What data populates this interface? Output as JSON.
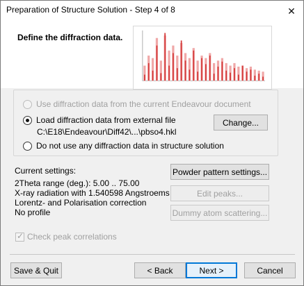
{
  "window": {
    "title": "Preparation of Structure Solution - Step 4 of 8",
    "close_glyph": "✕"
  },
  "header": {
    "heading": "Define the diffraction data."
  },
  "source_options": {
    "use_current": "Use diffraction data from the current Endeavour document",
    "load_external": "Load diffraction data from external file",
    "file_path": "C:\\E18\\Endeavour\\Diff42\\...\\pbso4.hkl",
    "do_not_use": "Do not use any diffraction data in structure solution",
    "selected": "load_external"
  },
  "buttons": {
    "change": "Change...",
    "powder_settings": "Powder pattern settings...",
    "edit_peaks": "Edit peaks...",
    "dummy_atom": "Dummy atom scattering...",
    "save_quit": "Save & Quit",
    "back": "< Back",
    "next": "Next >",
    "cancel": "Cancel"
  },
  "current_settings": {
    "label": "Current settings:",
    "lines": [
      "2Theta range (deg.): 5.00 .. 75.00",
      "X-ray radiation with 1.540598 Angstroems",
      "Lorentz- and Polarisation correction",
      "No profile"
    ]
  },
  "check_peak_correlations": {
    "label": "Check peak correlations",
    "checked": true,
    "enabled": false
  },
  "chart_data": {
    "type": "bar",
    "series": [
      {
        "color": "#d43a3a",
        "values": [
          0.12,
          0.35,
          0.2,
          0.7,
          0.15,
          0.95,
          0.3,
          0.55,
          0.25,
          0.8,
          0.4,
          0.22,
          0.6,
          0.18,
          0.45,
          0.33,
          0.5,
          0.14,
          0.28,
          0.38,
          0.2,
          0.16,
          0.25,
          0.12,
          0.3,
          0.18,
          0.22,
          0.1,
          0.14,
          0.08
        ]
      },
      {
        "color": "#f0a8a8",
        "values": [
          0.3,
          0.5,
          0.45,
          0.85,
          0.4,
          0.9,
          0.6,
          0.7,
          0.5,
          0.75,
          0.55,
          0.45,
          0.65,
          0.4,
          0.5,
          0.45,
          0.55,
          0.35,
          0.4,
          0.45,
          0.35,
          0.3,
          0.35,
          0.28,
          0.3,
          0.25,
          0.28,
          0.22,
          0.2,
          0.18
        ]
      }
    ],
    "ylim": [
      0,
      1
    ]
  }
}
